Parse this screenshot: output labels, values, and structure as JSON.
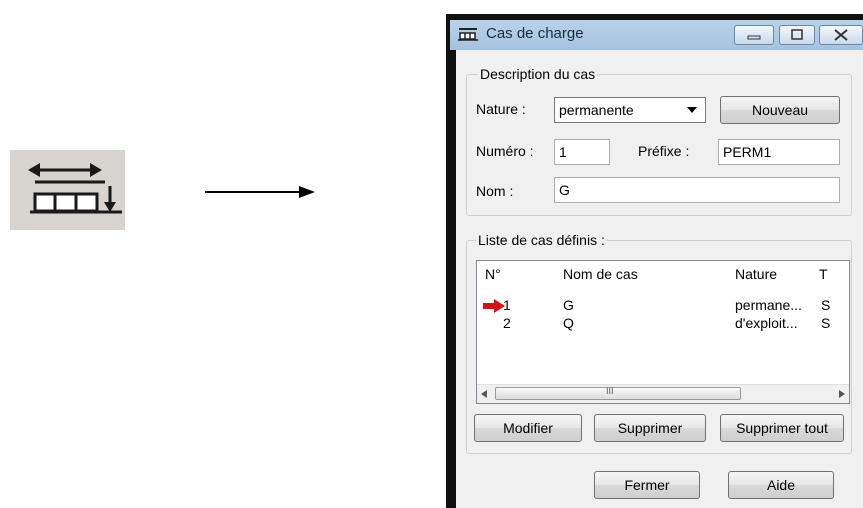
{
  "window": {
    "title": "Cas de charge"
  },
  "description_group": {
    "legend": "Description du cas",
    "nature_label": "Nature :",
    "nature_value": "permanente",
    "nouveau_label": "Nouveau",
    "numero_label": "Numéro :",
    "numero_value": "1",
    "prefixe_label": "Préfixe :",
    "prefixe_value": "PERM1",
    "nom_label": "Nom :",
    "nom_value": "G"
  },
  "list_group": {
    "legend": "Liste de cas définis :",
    "columns": [
      "N°",
      "Nom de cas",
      "Nature",
      "T"
    ],
    "rows": [
      {
        "num": "1",
        "name": "G",
        "nature": "permane...",
        "extra": "S",
        "current": true
      },
      {
        "num": "2",
        "name": "Q",
        "nature": "d'exploit...",
        "extra": "S",
        "current": false
      }
    ],
    "scroll_grip": "III"
  },
  "buttons": {
    "modifier": "Modifier",
    "supprimer": "Supprimer",
    "supprimer_tout": "Supprimer tout",
    "fermer": "Fermer",
    "aide": "Aide"
  },
  "colors": {
    "current_row_arrow": "#d0141c",
    "titlebar": "#b3cde6"
  }
}
